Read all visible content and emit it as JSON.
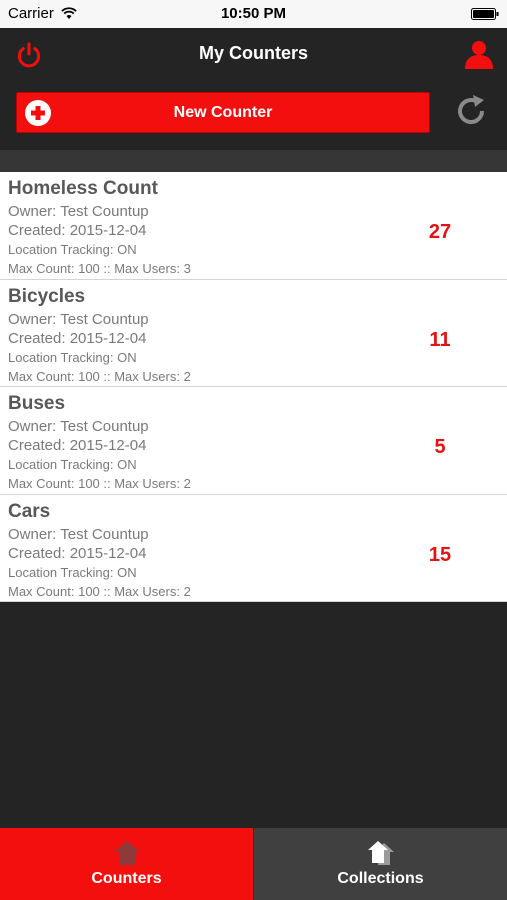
{
  "status_bar": {
    "carrier": "Carrier",
    "time": "10:50 PM"
  },
  "header": {
    "title": "My Counters",
    "left_icon": "power-icon",
    "right_icon": "profile-icon"
  },
  "toolbar": {
    "new_counter_label": "New Counter",
    "new_counter_icon": "plus-circle-icon",
    "refresh_icon": "refresh-icon"
  },
  "colors": {
    "accent": "#f40f0f",
    "count": "#e41212",
    "background": "#242424",
    "inactive_tab": "#404040"
  },
  "counters": [
    {
      "name": "Homeless Count",
      "owner": "Owner: Test Countup",
      "created": "Created: 2015-12-04",
      "tracking": "Location Tracking: ON",
      "limits": "Max Count: 100 :: Max Users: 3",
      "count": "27"
    },
    {
      "name": "Bicycles",
      "owner": "Owner: Test Countup",
      "created": "Created: 2015-12-04",
      "tracking": "Location Tracking: ON",
      "limits": "Max Count: 100 :: Max Users: 2",
      "count": "11"
    },
    {
      "name": "Buses",
      "owner": "Owner: Test Countup",
      "created": "Created: 2015-12-04",
      "tracking": "Location Tracking: ON",
      "limits": "Max Count: 100 :: Max Users: 2",
      "count": "5"
    },
    {
      "name": "Cars",
      "owner": "Owner: Test Countup",
      "created": "Created: 2015-12-04",
      "tracking": "Location Tracking: ON",
      "limits": "Max Count: 100 :: Max Users: 2",
      "count": "15"
    }
  ],
  "tabs": [
    {
      "label": "Counters",
      "icon": "home-icon",
      "selected": true
    },
    {
      "label": "Collections",
      "icon": "collections-icon",
      "selected": false
    }
  ]
}
